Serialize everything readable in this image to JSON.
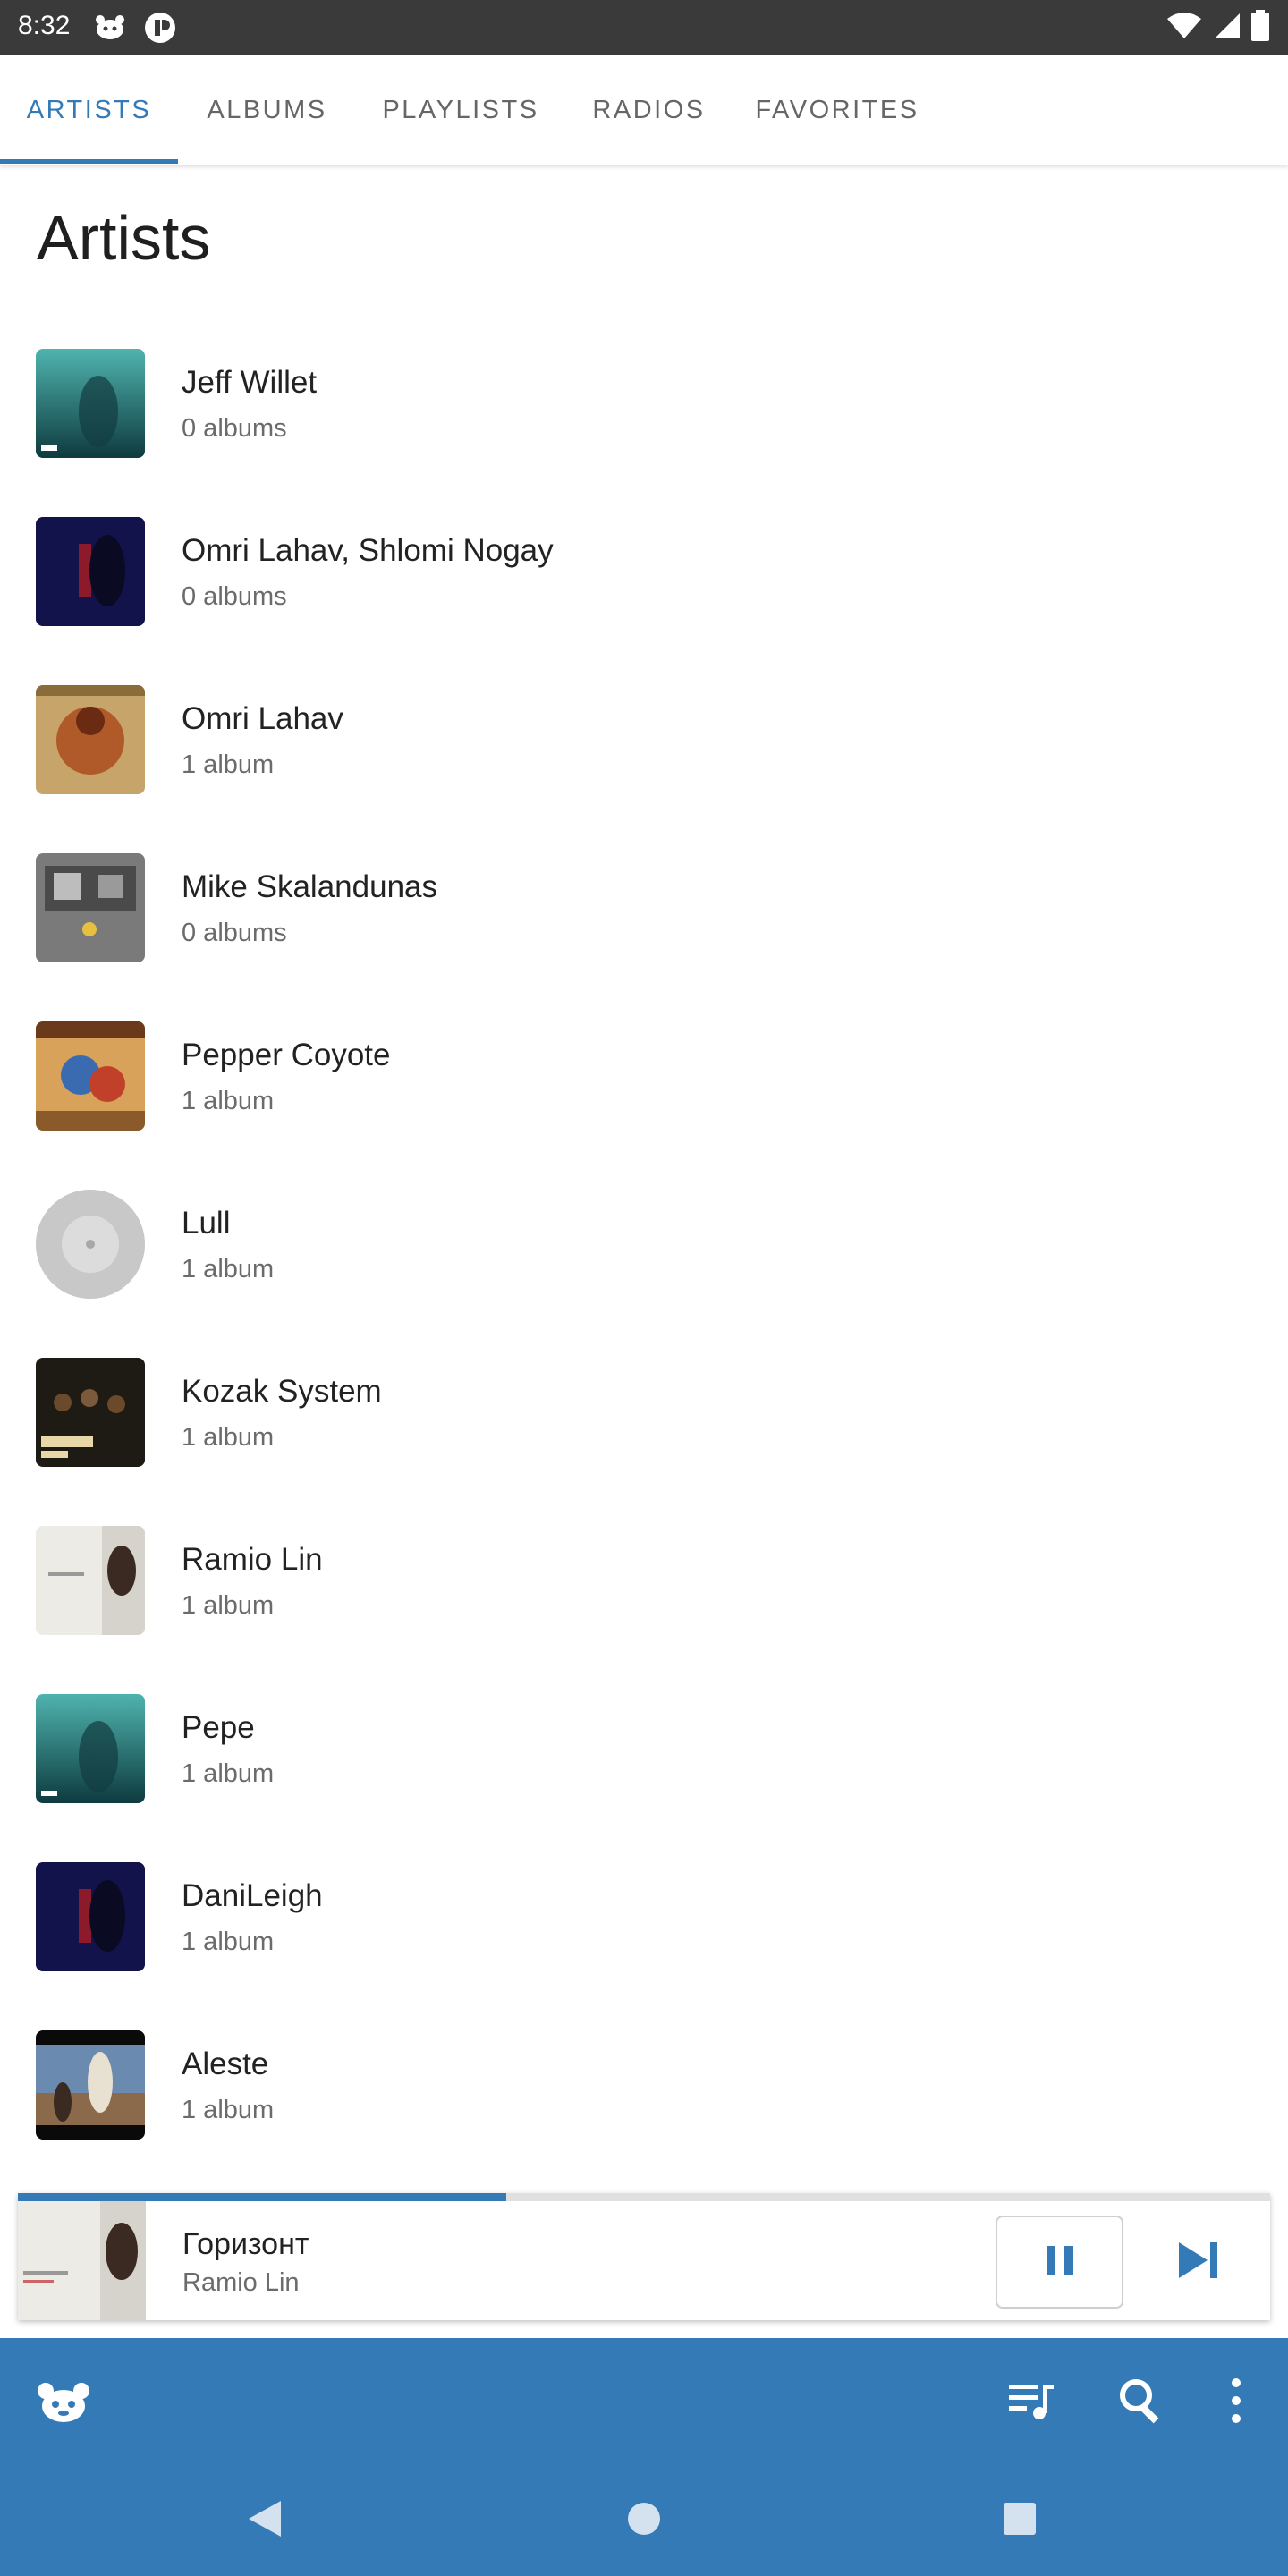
{
  "status_bar": {
    "time": "8:32",
    "icons": [
      "funkwhale-notification-icon",
      "app-notification-icon",
      "wifi-icon",
      "signal-icon",
      "battery-icon"
    ]
  },
  "tabs": [
    {
      "label": "ARTISTS",
      "active": true
    },
    {
      "label": "ALBUMS",
      "active": false
    },
    {
      "label": "PLAYLISTS",
      "active": false
    },
    {
      "label": "RADIOS",
      "active": false
    },
    {
      "label": "FAVORITES",
      "active": false
    }
  ],
  "page": {
    "title": "Artists"
  },
  "artists": [
    {
      "name": "Jeff Willet",
      "count": "0 albums",
      "art": "teal-underwater"
    },
    {
      "name": "Omri Lahav, Shlomi Nogay",
      "count": "0 albums",
      "art": "dark-blue-room"
    },
    {
      "name": "Omri Lahav",
      "count": "1 album",
      "art": "gold-warrior"
    },
    {
      "name": "Mike Skalandunas",
      "count": "0 albums",
      "art": "grey-graffiti"
    },
    {
      "name": "Pepper Coyote",
      "count": "1 album",
      "art": "comic-cover"
    },
    {
      "name": "Lull",
      "count": "1 album",
      "art": "placeholder-disc"
    },
    {
      "name": "Kozak System",
      "count": "1 album",
      "art": "dark-crowd"
    },
    {
      "name": "Ramio Lin",
      "count": "1 album",
      "art": "white-room"
    },
    {
      "name": "Pepe",
      "count": "1 album",
      "art": "teal-underwater"
    },
    {
      "name": "DaniLeigh",
      "count": "1 album",
      "art": "dark-blue-room"
    },
    {
      "name": "Aleste",
      "count": "1 album",
      "art": "street-scene"
    }
  ],
  "player": {
    "title": "Горизонт",
    "artist": "Ramio Lin",
    "progress": 0.39,
    "state": "playing"
  },
  "app_bar": {
    "icons": [
      "funkwhale-logo-icon",
      "queue-icon",
      "search-icon",
      "more-vert-icon"
    ]
  },
  "colors": {
    "accent": "#337ab7",
    "status_bar": "#3a3a3a",
    "text_primary": "#222222",
    "text_secondary": "#6b6b6b"
  }
}
